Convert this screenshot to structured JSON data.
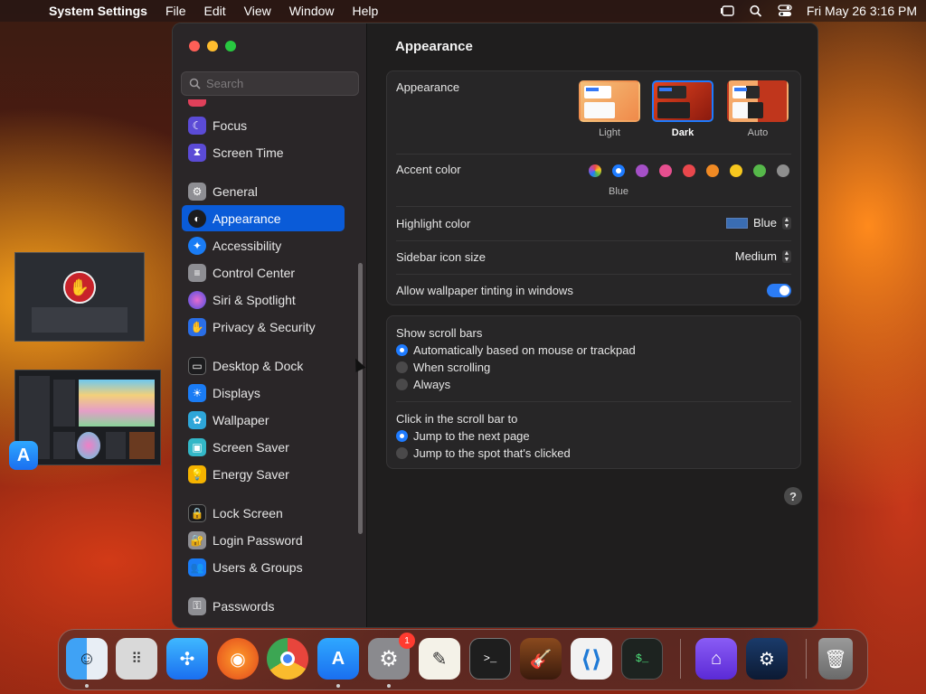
{
  "menubar": {
    "app_name": "System Settings",
    "menus": [
      "File",
      "Edit",
      "View",
      "Window",
      "Help"
    ],
    "clock": "Fri May 26  3:16 PM"
  },
  "sidebar": {
    "search_placeholder": "Search",
    "items": [
      {
        "label": "Focus",
        "icon": "moon-icon",
        "color": "#5b4bd6"
      },
      {
        "label": "Screen Time",
        "icon": "hourglass-icon",
        "color": "#5b4bd6"
      },
      {
        "label": "General",
        "icon": "gear-icon",
        "color": "#8e8e93"
      },
      {
        "label": "Appearance",
        "icon": "appearance-icon",
        "color": "#1c1c1e"
      },
      {
        "label": "Accessibility",
        "icon": "accessibility-icon",
        "color": "#1a7cf5"
      },
      {
        "label": "Control Center",
        "icon": "control-center-icon",
        "color": "#8e8e93"
      },
      {
        "label": "Siri & Spotlight",
        "icon": "siri-icon",
        "color": "#b14be0"
      },
      {
        "label": "Privacy & Security",
        "icon": "hand-icon",
        "color": "#2a6ee6"
      },
      {
        "label": "Desktop & Dock",
        "icon": "desktop-icon",
        "color": "#1c1c1e"
      },
      {
        "label": "Displays",
        "icon": "sun-icon",
        "color": "#1a7cf5"
      },
      {
        "label": "Wallpaper",
        "icon": "flower-icon",
        "color": "#2ea6d9"
      },
      {
        "label": "Screen Saver",
        "icon": "screen-saver-icon",
        "color": "#33b7c7"
      },
      {
        "label": "Energy Saver",
        "icon": "bulb-icon",
        "color": "#f5b300"
      },
      {
        "label": "Lock Screen",
        "icon": "lock-icon",
        "color": "#1c1c1e"
      },
      {
        "label": "Login Password",
        "icon": "padlock-icon",
        "color": "#8e8e93"
      },
      {
        "label": "Users & Groups",
        "icon": "users-icon",
        "color": "#1a7cf5"
      },
      {
        "label": "Passwords",
        "icon": "key-icon",
        "color": "#8e8e93"
      }
    ]
  },
  "content": {
    "title": "Appearance",
    "appearance": {
      "label": "Appearance",
      "options": [
        "Light",
        "Dark",
        "Auto"
      ],
      "selected": "Dark"
    },
    "accent": {
      "label": "Accent color",
      "selected_name": "Blue",
      "colors": [
        "multicolor",
        "#1e7bff",
        "#a550c7",
        "#e64f8f",
        "#e9474c",
        "#f08a24",
        "#f7c71e",
        "#56b84a",
        "#8e8e8e"
      ]
    },
    "highlight": {
      "label": "Highlight color",
      "value": "Blue"
    },
    "sidebar_icon_size": {
      "label": "Sidebar icon size",
      "value": "Medium"
    },
    "wallpaper_tinting": {
      "label": "Allow wallpaper tinting in windows",
      "on": true
    },
    "scroll_bars": {
      "label": "Show scroll bars",
      "options": [
        "Automatically based on mouse or trackpad",
        "When scrolling",
        "Always"
      ]
    },
    "click_scroll": {
      "label": "Click in the scroll bar to",
      "options": [
        "Jump to the next page",
        "Jump to the spot that's clicked"
      ]
    },
    "help": "?"
  },
  "dock": {
    "badge_count": "1"
  }
}
